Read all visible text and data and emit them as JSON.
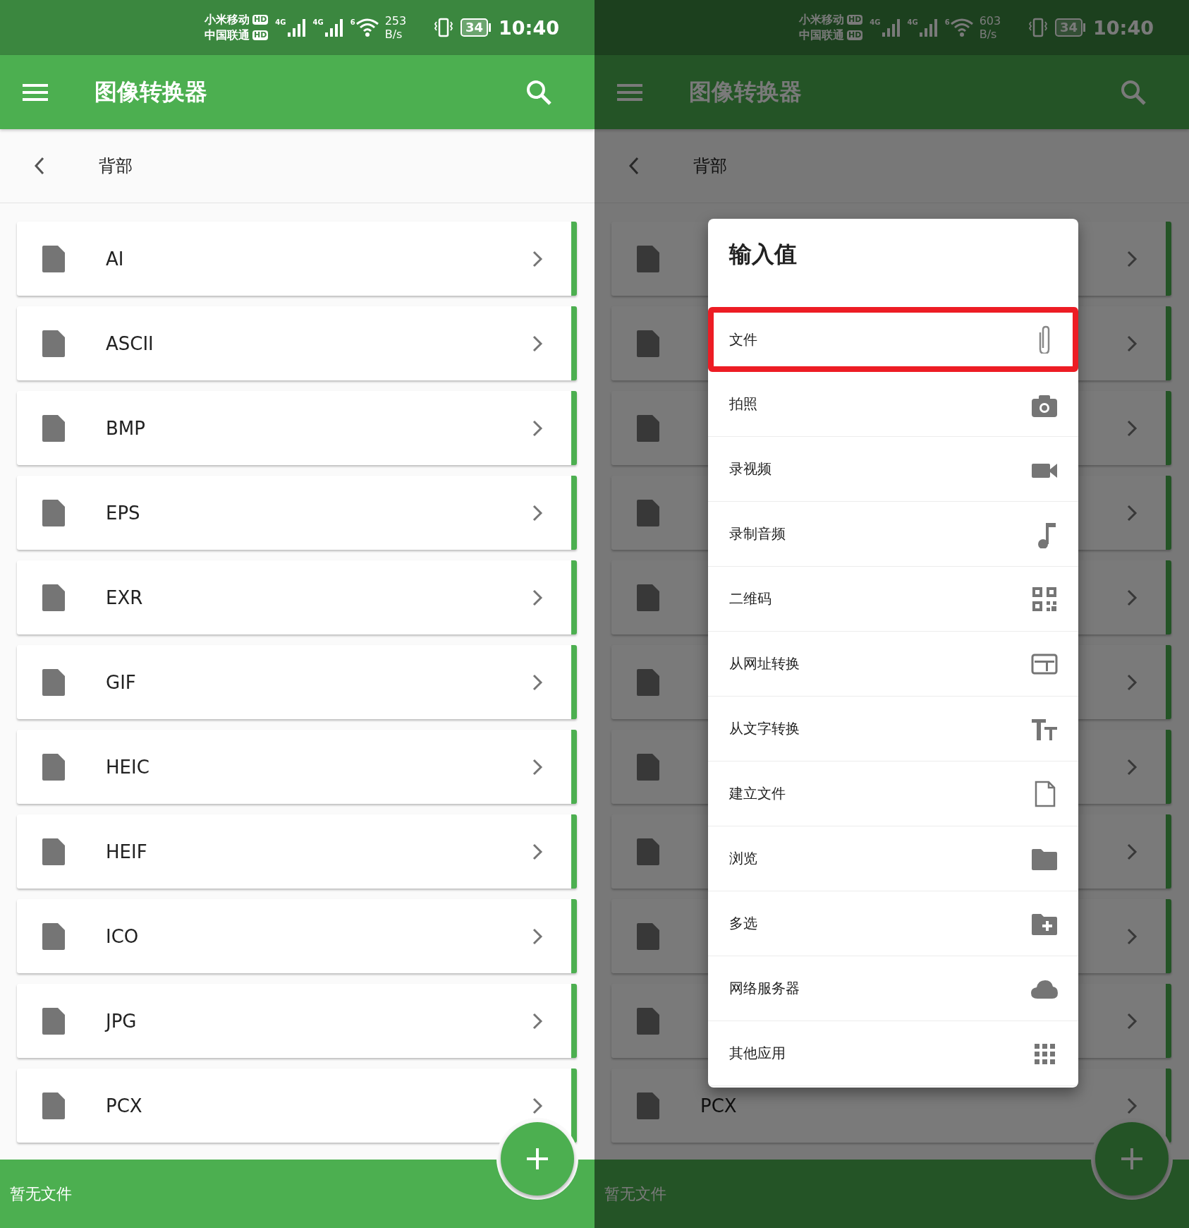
{
  "screens": [
    {
      "dimmed": false,
      "status_bar": {
        "carriers": [
          {
            "name": "小米移动",
            "badge": "HD"
          },
          {
            "name": "中国联通",
            "badge": "HD"
          }
        ],
        "signals": [
          {
            "label": "4G"
          },
          {
            "label": "4G"
          }
        ],
        "wifi_label": "6",
        "speed": "253",
        "speed_unit": "B/s",
        "battery": "34",
        "time": "10:40"
      },
      "app_bar": {
        "title": "图像转换器"
      },
      "back_row": {
        "label": "背部"
      },
      "formats": [
        {
          "kind": "format",
          "label": "AI"
        },
        {
          "kind": "format",
          "label": "ASCII"
        },
        {
          "kind": "format",
          "label": "BMP"
        },
        {
          "kind": "format",
          "label": "EPS"
        },
        {
          "kind": "format",
          "label": "EXR"
        },
        {
          "kind": "format",
          "label": "GIF"
        },
        {
          "kind": "format",
          "label": "HEIC"
        },
        {
          "kind": "format",
          "label": "HEIF"
        },
        {
          "kind": "format",
          "label": "ICO"
        },
        {
          "kind": "format",
          "label": "JPG"
        },
        {
          "kind": "format",
          "label": "PCX"
        }
      ],
      "bottom_bar": {
        "text": "暂无文件"
      }
    },
    {
      "dimmed": true,
      "status_bar": {
        "carriers": [
          {
            "name": "小米移动",
            "badge": "HD"
          },
          {
            "name": "中国联通",
            "badge": "HD"
          }
        ],
        "signals": [
          {
            "label": "4G"
          },
          {
            "label": "4G"
          }
        ],
        "wifi_label": "6",
        "speed": "603",
        "speed_unit": "B/s",
        "battery": "34",
        "time": "10:40"
      },
      "app_bar": {
        "title": "图像转换器"
      },
      "back_row": {
        "label": "背部"
      },
      "formats": [
        {
          "kind": "covered"
        },
        {
          "kind": "covered"
        },
        {
          "kind": "covered"
        },
        {
          "kind": "covered"
        },
        {
          "kind": "covered"
        },
        {
          "kind": "covered"
        },
        {
          "kind": "covered"
        },
        {
          "kind": "covered"
        },
        {
          "kind": "covered"
        },
        {
          "kind": "covered"
        },
        {
          "kind": "format",
          "label": "PCX"
        }
      ],
      "bottom_bar": {
        "text": "暂无文件"
      },
      "dialog": {
        "title": "输入值",
        "options": [
          {
            "label": "文件",
            "selected": true
          },
          {
            "label": "拍照",
            "selected": false
          },
          {
            "label": "录视频",
            "selected": false
          },
          {
            "label": "录制音频",
            "selected": false
          },
          {
            "label": "二维码",
            "selected": false
          },
          {
            "label": "从网址转换",
            "selected": false
          },
          {
            "label": "从文字转换",
            "selected": false
          },
          {
            "label": "建立文件",
            "selected": false
          },
          {
            "label": "浏览",
            "selected": false
          },
          {
            "label": "多选",
            "selected": false
          },
          {
            "label": "网络服务器",
            "selected": false
          },
          {
            "label": "其他应用",
            "selected": false
          }
        ]
      }
    }
  ]
}
